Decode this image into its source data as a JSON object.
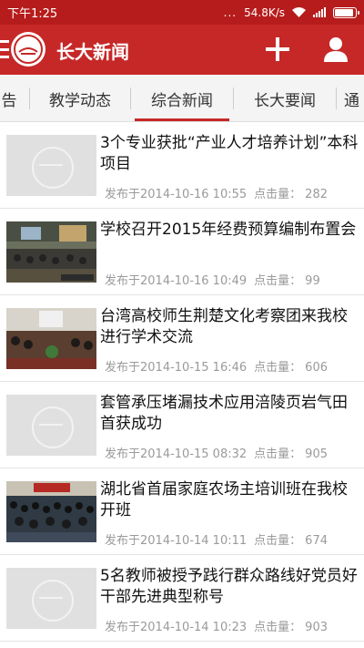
{
  "status_bar": {
    "time": "下午1:25",
    "dots": "...",
    "speed": "54.8K/s"
  },
  "app_bar": {
    "title": "长大新闻"
  },
  "tabs": [
    {
      "label": "告"
    },
    {
      "label": "教学动态"
    },
    {
      "label": "综合新闻",
      "active": true
    },
    {
      "label": "长大要闻"
    },
    {
      "label": "通"
    }
  ],
  "news": [
    {
      "title": "3个专业获批“产业人才培养计划”本科项目",
      "posted": "发布于2014-10-16 10:55",
      "views_label": "点击量：",
      "views": "282",
      "thumb": "placeholder"
    },
    {
      "title": "学校召开2015年经费预算编制布置会",
      "posted": "发布于2014-10-16 10:49",
      "views_label": "点击量：",
      "views": "99",
      "thumb": "photo-meeting"
    },
    {
      "title": "台湾高校师生荆楚文化考察团来我校进行学术交流",
      "posted": "发布于2014-10-15 16:46",
      "views_label": "点击量：",
      "views": "606",
      "thumb": "photo-conference"
    },
    {
      "title": "套管承压堵漏技术应用涪陵页岩气田首获成功",
      "posted": "发布于2014-10-15 08:32",
      "views_label": "点击量：",
      "views": "905",
      "thumb": "placeholder"
    },
    {
      "title": "湖北省首届家庭农场主培训班在我校开班",
      "posted": "发布于2014-10-14 10:11",
      "views_label": "点击量：",
      "views": "674",
      "thumb": "photo-class"
    },
    {
      "title": "5名教师被授予践行群众路线好党员好干部先进典型称号",
      "posted": "发布于2014-10-14 10:23",
      "views_label": "点击量：",
      "views": "903",
      "thumb": "placeholder"
    }
  ]
}
